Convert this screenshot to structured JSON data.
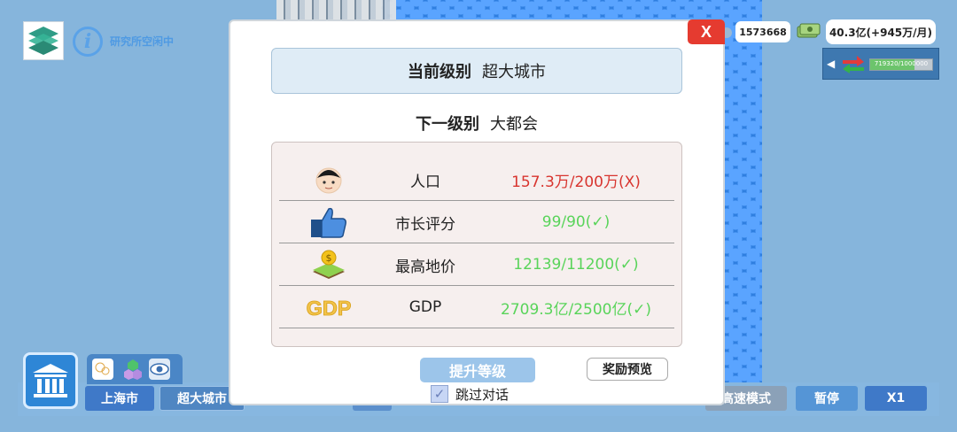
{
  "hud": {
    "research_status": "研究所空闲中",
    "population_count": "1573668",
    "income": "40.3亿(+945万/月)",
    "trade_progress_text": "719320/1000000",
    "trade_progress": 0.72
  },
  "bottom_bar": {
    "city_name": "上海市",
    "city_level": "超大城市",
    "speed_mode": "高速模式",
    "pause": "暂停",
    "speed": "X1"
  },
  "dialog": {
    "close_label": "X",
    "current_level_label": "当前级别",
    "current_level_value": "超大城市",
    "next_level_label": "下一级别",
    "next_level_value": "大都会",
    "requirements": [
      {
        "icon": "person-icon",
        "name": "人口",
        "value": "157.3万/200万(X)",
        "status": "fail"
      },
      {
        "icon": "thumbs-up-icon",
        "name": "市长评分",
        "value": "99/90(✓)",
        "status": "ok"
      },
      {
        "icon": "land-price-icon",
        "name": "最高地价",
        "value": "12139/11200(✓)",
        "status": "ok"
      },
      {
        "icon": "gdp-icon",
        "name": "GDP",
        "value": "2709.3亿/2500亿(✓)",
        "status": "ok"
      }
    ],
    "upgrade_button": "提升等级",
    "reward_button": "奖励预览",
    "skip_dialog_label": "跳过对话",
    "skip_dialog_checked": true
  },
  "colors": {
    "fail": "#d8352f",
    "ok": "#59d45a",
    "close": "#e53b30",
    "primary_button": "#3f79c8"
  }
}
